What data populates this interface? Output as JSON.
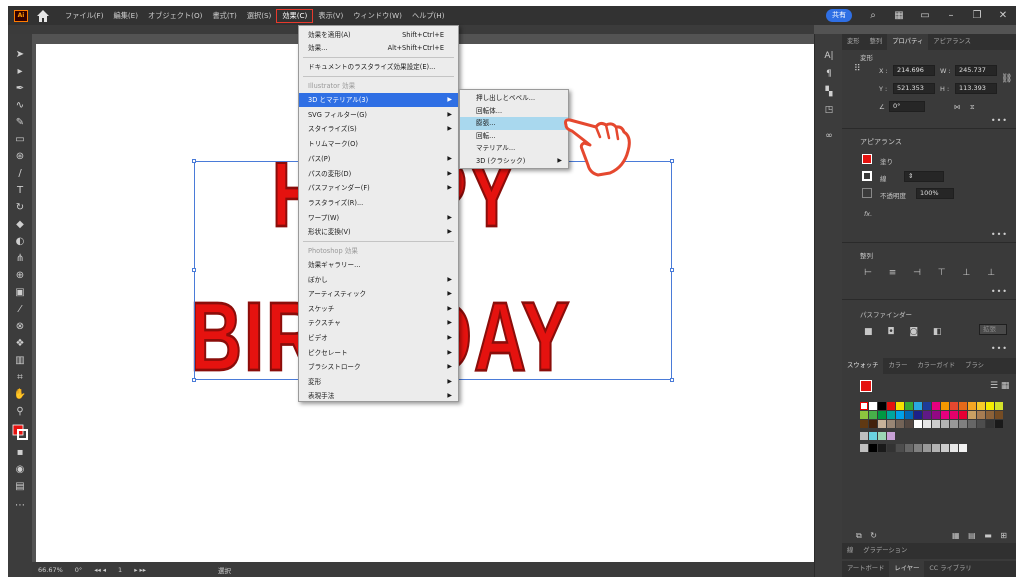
{
  "menubar": {
    "logo": "Ai",
    "items": [
      "ファイル(F)",
      "編集(E)",
      "オブジェクト(O)",
      "書式(T)",
      "選択(S)",
      "効果(C)",
      "表示(V)",
      "ウィンドウ(W)",
      "ヘルプ(H)"
    ],
    "active_index": 5,
    "share_label": "共有"
  },
  "effect_menu": {
    "apply_last": {
      "label": "効果を適用(A)",
      "shortcut": "Shift+Ctrl+E"
    },
    "last_effect": {
      "label": "効果...",
      "shortcut": "Alt+Shift+Ctrl+E"
    },
    "doc_raster": "ドキュメントのラスタライズ効果設定(E)...",
    "illustrator_header": "Illustrator 効果",
    "illustrator_items": [
      {
        "label": "3D とマテリアル(3)",
        "sub": true
      },
      {
        "label": "SVG フィルター(G)",
        "sub": true
      },
      {
        "label": "スタイライズ(S)",
        "sub": true
      },
      {
        "label": "トリムマーク(O)",
        "sub": false
      },
      {
        "label": "パス(P)",
        "sub": true
      },
      {
        "label": "パスの変形(D)",
        "sub": true
      },
      {
        "label": "パスファインダー(F)",
        "sub": true
      },
      {
        "label": "ラスタライズ(R)...",
        "sub": false
      },
      {
        "label": "ワープ(W)",
        "sub": true
      },
      {
        "label": "形状に変換(V)",
        "sub": true
      }
    ],
    "photoshop_header": "Photoshop 効果",
    "photoshop_items": [
      {
        "label": "効果ギャラリー...",
        "sub": false
      },
      {
        "label": "ぼかし",
        "sub": true
      },
      {
        "label": "アーティスティック",
        "sub": true
      },
      {
        "label": "スケッチ",
        "sub": true
      },
      {
        "label": "テクスチャ",
        "sub": true
      },
      {
        "label": "ビデオ",
        "sub": true
      },
      {
        "label": "ピクセレート",
        "sub": true
      },
      {
        "label": "ブラシストローク",
        "sub": true
      },
      {
        "label": "変形",
        "sub": true
      },
      {
        "label": "表現手法",
        "sub": true
      }
    ]
  },
  "submenu_3d": {
    "items": [
      {
        "label": "押し出しとベベル...",
        "sub": false
      },
      {
        "label": "回転体...",
        "sub": false
      },
      {
        "label": "膨張...",
        "sub": false,
        "highlighted": true
      },
      {
        "label": "回転...",
        "sub": false
      },
      {
        "label": "マテリアル...",
        "sub": false
      },
      {
        "label": "3D (クラシック)",
        "sub": true
      }
    ]
  },
  "artwork": {
    "line1": "HAPPY",
    "line2": "BIRTHDAY",
    "fill_color": "#e5120f",
    "stroke_color": "#8b0d0a"
  },
  "statusbar": {
    "zoom": "66.67%",
    "rotation": "0°",
    "artboard": "1",
    "tool": "選択"
  },
  "panel": {
    "tabs": [
      "変形",
      "整列",
      "プロパティ",
      "アピアランス"
    ],
    "active_tab": 2,
    "transform_label": "変形",
    "x_label": "X :",
    "x_value": "214.696",
    "y_label": "Y :",
    "y_value": "521.353",
    "w_label": "W :",
    "w_value": "245.737",
    "h_label": "H :",
    "h_value": "113.393",
    "angle_value": "0°",
    "appearance_label": "アピアランス",
    "fill_label": "塗り",
    "stroke_label": "線",
    "opacity_label": "不透明度",
    "opacity_value": "100%",
    "fx_label": "fx.",
    "align_label": "整列",
    "pathfinder_label": "パスファインダー",
    "expand_label": "拡張",
    "swatch_tabs": [
      "スウォッチ",
      "カラー",
      "カラーガイド",
      "ブラシ"
    ],
    "bottom_tabs1": [
      "線",
      "グラデーション"
    ],
    "bottom_tabs2": [
      "アートボード",
      "レイヤー",
      "CC ライブラリ"
    ],
    "accent_color": "#2f6fe4"
  }
}
